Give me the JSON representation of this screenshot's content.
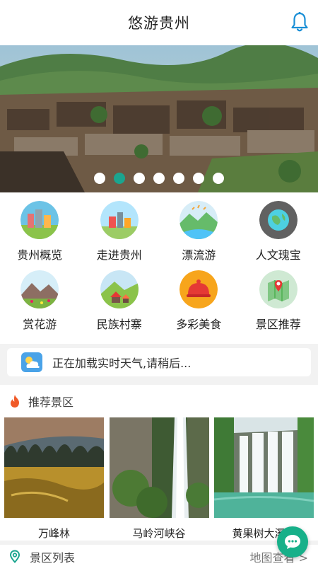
{
  "header": {
    "title": "悠游贵州"
  },
  "banner": {
    "dot_count": 7,
    "active_index": 1
  },
  "grid": [
    {
      "label": "贵州概览",
      "icon": "city-icon"
    },
    {
      "label": "走进贵州",
      "icon": "town-icon"
    },
    {
      "label": "漂流游",
      "icon": "river-icon"
    },
    {
      "label": "人文瑰宝",
      "icon": "globe-icon"
    },
    {
      "label": "赏花游",
      "icon": "flower-mountain-icon"
    },
    {
      "label": "民族村寨",
      "icon": "village-icon"
    },
    {
      "label": "多彩美食",
      "icon": "food-dome-icon"
    },
    {
      "label": "景区推荐",
      "icon": "map-pin-icon"
    }
  ],
  "weather": {
    "text": "正在加载实时天气,请稍后..."
  },
  "recommend": {
    "title": "推荐景区",
    "items": [
      {
        "name": "万峰林"
      },
      {
        "name": "马岭河峡谷"
      },
      {
        "name": "黄果树大瀑布"
      }
    ]
  },
  "list": {
    "title": "景区列表",
    "map_link": "地图查看 >"
  },
  "colors": {
    "accent": "#1ba58f",
    "chat": "#17b089",
    "fire": "#f05a28"
  }
}
